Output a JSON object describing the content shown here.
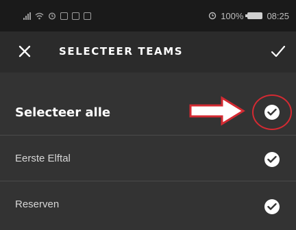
{
  "status_bar": {
    "battery_text": "100%",
    "time": "08:25",
    "icons": [
      "signal-icon",
      "wifi-icon",
      "alarm-icon",
      "nfc-icon",
      "mail-icon",
      "sync-icon",
      "clock-icon",
      "battery-icon"
    ]
  },
  "toolbar": {
    "close_icon": "close-icon",
    "title": "SELECTEER TEAMS",
    "confirm_icon": "checkmark-icon"
  },
  "select_all": {
    "label": "Selecteer alle",
    "checked": true
  },
  "teams": [
    {
      "label": "Eerste Elftal",
      "checked": true
    },
    {
      "label": "Reserven",
      "checked": true
    }
  ],
  "annotation": {
    "arrow_icon": "red-arrow-icon",
    "highlight": "red-circle-highlight",
    "color": "#d42a32"
  },
  "colors": {
    "background": "#333333",
    "toolbar": "#2b2b2b",
    "statusbar": "#1a1a1a",
    "divider": "#4a4a4a",
    "text": "#ffffff"
  }
}
